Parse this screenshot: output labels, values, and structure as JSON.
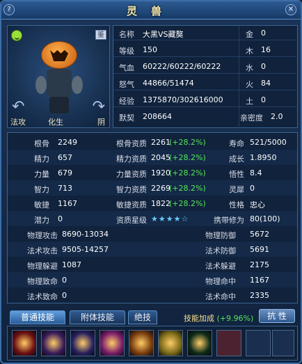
{
  "window": {
    "title": "灵兽",
    "help_glyph": "?",
    "close_glyph": "✕"
  },
  "portrait": {
    "labels": {
      "left": "法攻",
      "mid": "化生",
      "right": "阴"
    },
    "arrow_left": "↶",
    "arrow_right": "↷",
    "eye": "鉴"
  },
  "info": {
    "rows": [
      {
        "k": "名称",
        "v": "大黑VS藏獒",
        "k2": "金",
        "v2": "0"
      },
      {
        "k": "等级",
        "v": "150",
        "k2": "木",
        "v2": "16"
      },
      {
        "k": "气血",
        "v": "60222/60222/60222",
        "k2": "水",
        "v2": "0"
      },
      {
        "k": "怒气",
        "v": "44866/51474",
        "k2": "火",
        "v2": "84"
      },
      {
        "k": "经验",
        "v": "1375870/302616000",
        "k2": "土",
        "v2": "0"
      },
      {
        "k": "默契",
        "v": "208664",
        "k2": "亲密度",
        "v2": "2.0"
      }
    ]
  },
  "stats": {
    "rows": [
      {
        "a": "根骨",
        "av": "2249",
        "b": "根骨资质",
        "bv": "2261",
        "bp": "(+28.2%)",
        "c": "寿命",
        "cv": "521/5000"
      },
      {
        "a": "精力",
        "av": "657",
        "b": "精力资质",
        "bv": "2045",
        "bp": "(+28.2%)",
        "c": "成长",
        "cv": "1.8950"
      },
      {
        "a": "力量",
        "av": "679",
        "b": "力量资质",
        "bv": "1920",
        "bp": "(+28.2%)",
        "c": "悟性",
        "cv": "8.4"
      },
      {
        "a": "智力",
        "av": "713",
        "b": "智力资质",
        "bv": "2269",
        "bp": "(+28.2%)",
        "c": "灵犀",
        "cv": "0"
      },
      {
        "a": "敏捷",
        "av": "1167",
        "b": "敏捷资质",
        "bv": "1822",
        "bp": "(+28.2%)",
        "c": "性格",
        "cv": "忠心"
      },
      {
        "a": "潜力",
        "av": "0",
        "b": "资质星级",
        "bv": "★★★★☆",
        "bp": "",
        "c": "携带修为",
        "cv": "80(100)"
      }
    ],
    "wide": [
      {
        "a": "物理攻击",
        "av": "8690-13034",
        "c": "物理防御",
        "cv": "5672"
      },
      {
        "a": "法术攻击",
        "av": "9505-14257",
        "c": "法术防御",
        "cv": "5691"
      },
      {
        "a": "物理躲避",
        "av": "1087",
        "c": "法术躲避",
        "cv": "2175"
      },
      {
        "a": "物理致命",
        "av": "0",
        "c": "物理命中",
        "cv": "1167"
      },
      {
        "a": "法术致命",
        "av": "0",
        "c": "法术命中",
        "cv": "2335"
      }
    ]
  },
  "tabs": {
    "normal": "普通技能",
    "attached": "附体技能",
    "ultimate": "绝技",
    "resist": "抗 性"
  },
  "bonus": {
    "label": "技能加成",
    "value": "(+9.96%)"
  },
  "skills": {
    "icons": [
      "#6b1010",
      "#3a1b5a",
      "#27205e",
      "#7a1d6a",
      "#7a3d0d",
      "#7a6a18",
      "#0c2a18"
    ],
    "empty_highlight": "#4c2230"
  }
}
